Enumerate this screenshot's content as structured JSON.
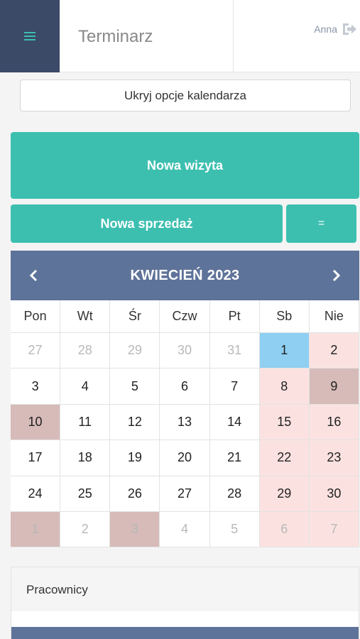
{
  "header": {
    "title": "Terminarz",
    "user_name": "Anna",
    "menu_icon": "hamburger-icon",
    "logout_icon": "logout-icon"
  },
  "actions": {
    "toggle_label": "Ukryj opcje kalendarza",
    "new_visit_label": "Nowa wizyta",
    "new_sale_label": "Nowa sprzedaż",
    "menu_label": "="
  },
  "calendar": {
    "title": "KWIECIEŃ 2023",
    "weekdays": [
      "Pon",
      "Wt",
      "Śr",
      "Czw",
      "Pt",
      "Sb",
      "Nie"
    ],
    "days": [
      {
        "label": "27",
        "muted": true
      },
      {
        "label": "28",
        "muted": true
      },
      {
        "label": "29",
        "muted": true
      },
      {
        "label": "30",
        "muted": true
      },
      {
        "label": "31",
        "muted": true
      },
      {
        "label": "1",
        "today": true
      },
      {
        "label": "2",
        "weekend": true
      },
      {
        "label": "3"
      },
      {
        "label": "4"
      },
      {
        "label": "5"
      },
      {
        "label": "6"
      },
      {
        "label": "7"
      },
      {
        "label": "8",
        "weekend": true
      },
      {
        "label": "9",
        "special": true
      },
      {
        "label": "10",
        "special": true
      },
      {
        "label": "11"
      },
      {
        "label": "12"
      },
      {
        "label": "13"
      },
      {
        "label": "14"
      },
      {
        "label": "15",
        "weekend": true
      },
      {
        "label": "16",
        "weekend": true
      },
      {
        "label": "17"
      },
      {
        "label": "18"
      },
      {
        "label": "19"
      },
      {
        "label": "20"
      },
      {
        "label": "21"
      },
      {
        "label": "22",
        "weekend": true
      },
      {
        "label": "23",
        "weekend": true
      },
      {
        "label": "24"
      },
      {
        "label": "25"
      },
      {
        "label": "26"
      },
      {
        "label": "27"
      },
      {
        "label": "28"
      },
      {
        "label": "29",
        "weekend": true
      },
      {
        "label": "30",
        "weekend": true
      },
      {
        "label": "1",
        "muted": true,
        "special": true
      },
      {
        "label": "2",
        "muted": true
      },
      {
        "label": "3",
        "muted": true,
        "special": true
      },
      {
        "label": "4",
        "muted": true
      },
      {
        "label": "5",
        "muted": true
      },
      {
        "label": "6",
        "muted": true,
        "weekend": true
      },
      {
        "label": "7",
        "muted": true,
        "weekend": true
      }
    ]
  },
  "staff_panel": {
    "title": "Pracownicy"
  },
  "colors": {
    "accent": "#3dbfb0",
    "header_dark": "#3b4a66",
    "calendar_header": "#5e7399",
    "weekend": "#fbe2e0",
    "special": "#d6bbb8",
    "today": "#8ecff2"
  }
}
